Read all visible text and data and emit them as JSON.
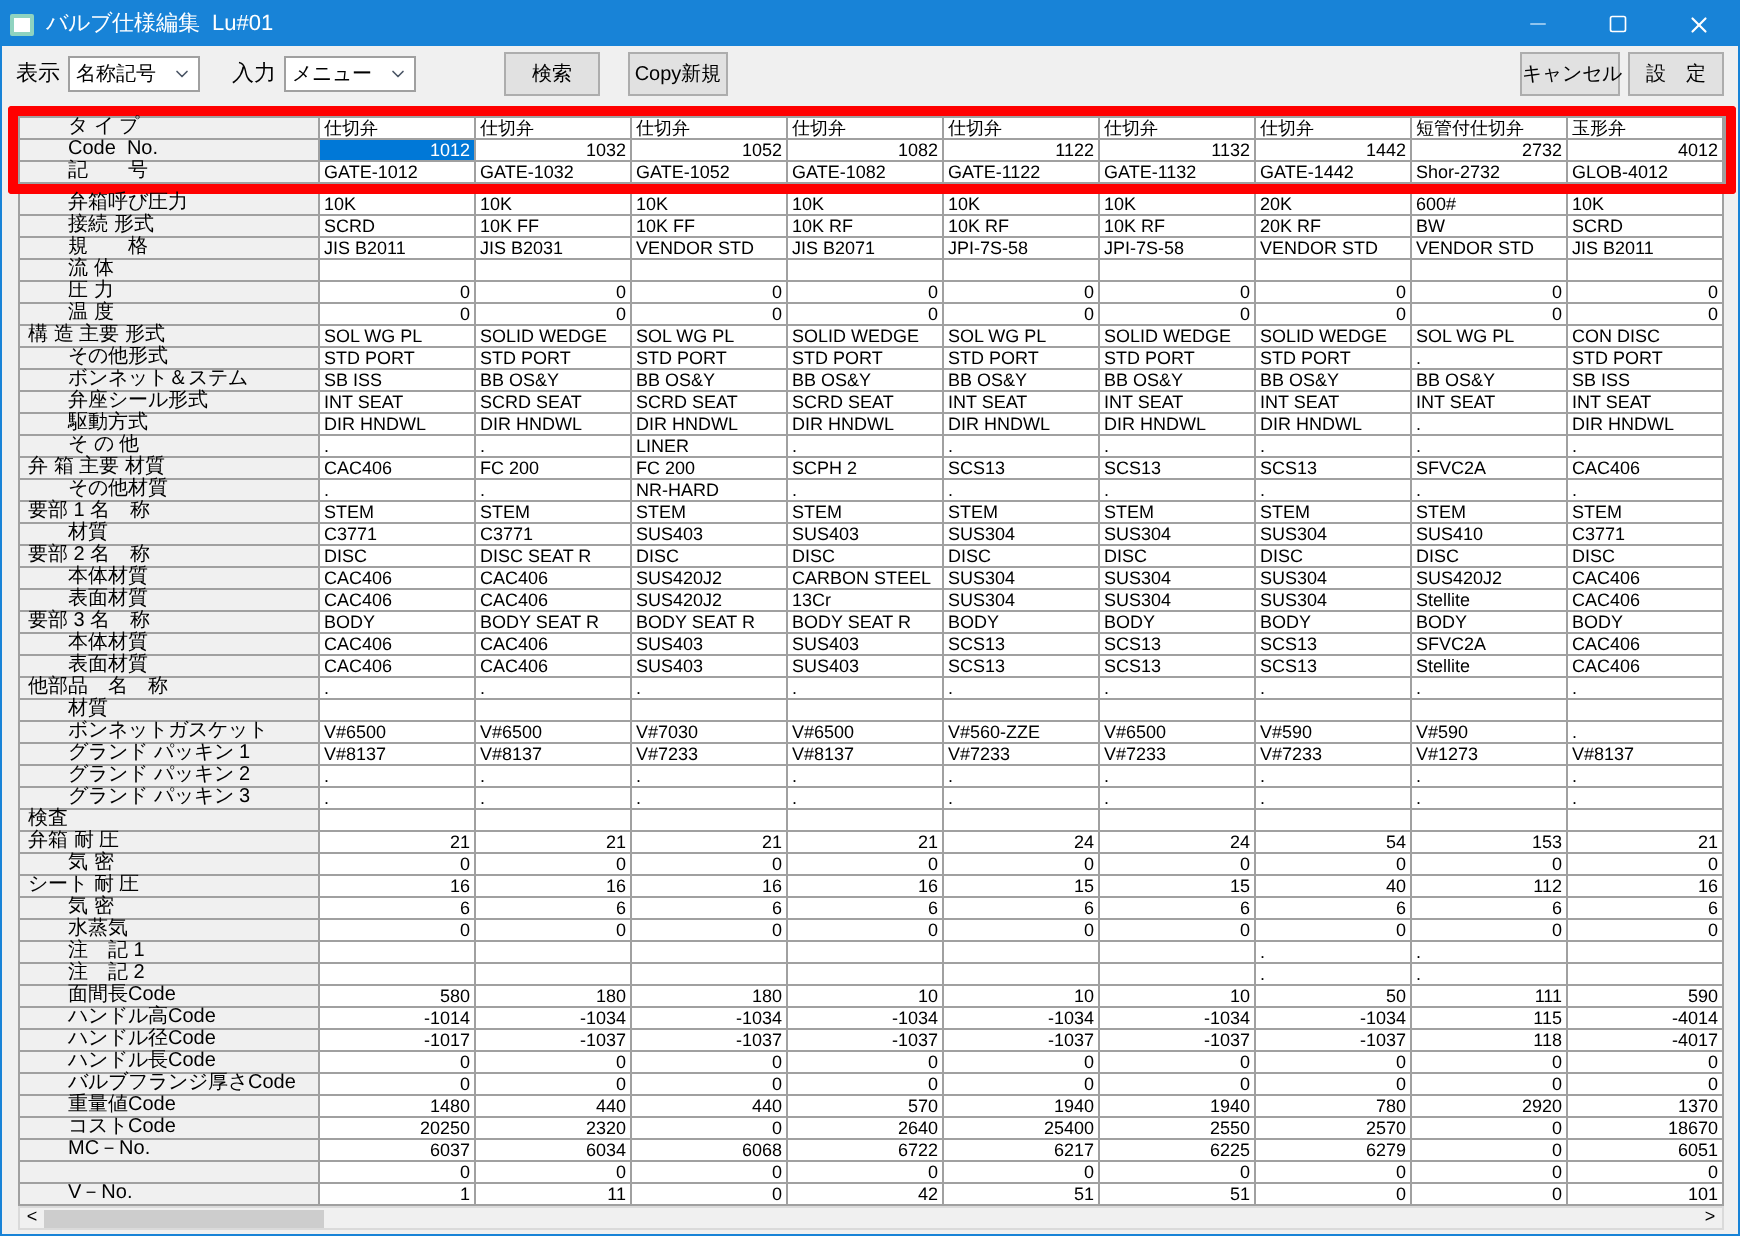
{
  "window": {
    "title": "バルブ仕様編集",
    "subtitle": "Lu#01"
  },
  "toolbar": {
    "display_label": "表示",
    "display_value": "名称記号",
    "input_label": "入力",
    "input_value": "メニュー",
    "search_button": "検索",
    "copy_button": "Copy新規",
    "cancel_button": "キャンセル",
    "ok_button": "設　定"
  },
  "rows": [
    {
      "label": "タ イ プ",
      "sub": true,
      "kind": "text",
      "highlighted": true,
      "values": [
        "仕切弁",
        "仕切弁",
        "仕切弁",
        "仕切弁",
        "仕切弁",
        "仕切弁",
        "仕切弁",
        "短管付仕切弁",
        "玉形弁"
      ]
    },
    {
      "label": "Code  No.",
      "sub": true,
      "kind": "number",
      "highlighted": true,
      "values": [
        {
          "text": "1012",
          "selected": true
        },
        {
          "text": "1032",
          "selected": false
        },
        {
          "text": "1052",
          "selected": false
        },
        {
          "text": "1082",
          "selected": false
        },
        {
          "text": "1122",
          "selected": false
        },
        {
          "text": "1132",
          "selected": false
        },
        {
          "text": "1442",
          "selected": false
        },
        {
          "text": "2732",
          "selected": false
        },
        {
          "text": "4012",
          "selected": false
        }
      ]
    },
    {
      "label": "記　　号",
      "sub": true,
      "kind": "text",
      "highlighted": true,
      "values": [
        "GATE-1012",
        "GATE-1032",
        "GATE-1052",
        "GATE-1082",
        "GATE-1122",
        "GATE-1132",
        "GATE-1442",
        "Shor-2732",
        "GLOB-4012"
      ]
    },
    {
      "label": "弁箱呼び圧力",
      "sub": true,
      "kind": "text",
      "highlighted": false,
      "values": [
        "10K",
        "10K",
        "10K",
        "10K",
        "10K",
        "10K",
        "20K",
        "600#",
        "10K"
      ]
    },
    {
      "label": "接続 形式",
      "sub": true,
      "kind": "text",
      "highlighted": false,
      "values": [
        "SCRD",
        "10K FF",
        "10K FF",
        "10K RF",
        "10K RF",
        "10K RF",
        "20K RF",
        "BW",
        "SCRD"
      ]
    },
    {
      "label": "規　　格",
      "sub": true,
      "kind": "text",
      "highlighted": false,
      "values": [
        "JIS B2011",
        "JIS B2031",
        "VENDOR STD",
        "JIS B2071",
        "JPI-7S-58",
        "JPI-7S-58",
        "VENDOR STD",
        "VENDOR STD",
        "JIS B2011"
      ]
    },
    {
      "label": "流 体",
      "sub": true,
      "kind": "text",
      "highlighted": false
    },
    {
      "label": "圧 力",
      "sub": true,
      "kind": "number",
      "highlighted": false,
      "values": [
        "0",
        "0",
        "0",
        "0",
        "0",
        "0",
        "0",
        "0",
        "0"
      ]
    },
    {
      "label": "温 度",
      "sub": true,
      "kind": "number",
      "highlighted": false,
      "values": [
        "0",
        "0",
        "0",
        "0",
        "0",
        "0",
        "0",
        "0",
        "0"
      ]
    },
    {
      "label": "構 造 主要 形式",
      "sub": false,
      "kind": "text",
      "highlighted": false,
      "values": [
        "SOL WG PL",
        "SOLID WEDGE",
        "SOL WG PL",
        "SOLID WEDGE",
        "SOL WG PL",
        "SOLID WEDGE",
        "SOLID WEDGE",
        "SOL WG PL",
        "CON DISC"
      ]
    },
    {
      "label": "その他形式",
      "sub": true,
      "kind": "text",
      "highlighted": false,
      "values": [
        "STD PORT",
        "STD PORT",
        "STD PORT",
        "STD PORT",
        "STD PORT",
        "STD PORT",
        "STD PORT",
        ".",
        "STD PORT"
      ]
    },
    {
      "label": "ボンネット＆ステム",
      "sub": true,
      "kind": "text",
      "highlighted": false,
      "values": [
        "SB ISS",
        "BB OS&Y",
        "BB OS&Y",
        "BB OS&Y",
        "BB OS&Y",
        "BB OS&Y",
        "BB OS&Y",
        "BB OS&Y",
        "SB ISS"
      ]
    },
    {
      "label": "弁座シール形式",
      "sub": true,
      "kind": "text",
      "highlighted": false,
      "values": [
        "INT SEAT",
        "SCRD SEAT",
        "SCRD SEAT",
        "SCRD SEAT",
        "INT SEAT",
        "INT SEAT",
        "INT SEAT",
        "INT SEAT",
        "INT SEAT"
      ]
    },
    {
      "label": "駆動方式",
      "sub": true,
      "kind": "text",
      "highlighted": false,
      "values": [
        "DIR HNDWL",
        "DIR HNDWL",
        "DIR HNDWL",
        "DIR HNDWL",
        "DIR HNDWL",
        "DIR HNDWL",
        "DIR HNDWL",
        ".",
        "DIR HNDWL"
      ]
    },
    {
      "label": "そ の 他",
      "sub": true,
      "kind": "text",
      "highlighted": false,
      "values": [
        ".",
        ".",
        "LINER",
        ".",
        ".",
        ".",
        ".",
        ".",
        "."
      ]
    },
    {
      "label": "弁 箱 主要 材質",
      "sub": false,
      "kind": "text",
      "highlighted": false,
      "values": [
        "CAC406",
        "FC 200",
        "FC 200",
        "SCPH 2",
        "SCS13",
        "SCS13",
        "SCS13",
        "SFVC2A",
        "CAC406"
      ]
    },
    {
      "label": "その他材質",
      "sub": true,
      "kind": "text",
      "highlighted": false,
      "values": [
        ".",
        ".",
        "NR-HARD",
        ".",
        ".",
        ".",
        ".",
        ".",
        "."
      ]
    },
    {
      "label": "要部 1 名　称",
      "sub": false,
      "kind": "text",
      "highlighted": false,
      "values": [
        "STEM",
        "STEM",
        "STEM",
        "STEM",
        "STEM",
        "STEM",
        "STEM",
        "STEM",
        "STEM"
      ]
    },
    {
      "label": "材質",
      "sub": true,
      "kind": "text",
      "highlighted": false,
      "values": [
        "C3771",
        "C3771",
        "SUS403",
        "SUS403",
        "SUS304",
        "SUS304",
        "SUS304",
        "SUS410",
        "C3771"
      ]
    },
    {
      "label": "要部 2 名　称",
      "sub": false,
      "kind": "text",
      "highlighted": false,
      "values": [
        "DISC",
        "DISC SEAT R",
        "DISC",
        "DISC",
        "DISC",
        "DISC",
        "DISC",
        "DISC",
        "DISC"
      ]
    },
    {
      "label": "本体材質",
      "sub": true,
      "kind": "text",
      "highlighted": false,
      "values": [
        "CAC406",
        "CAC406",
        "SUS420J2",
        "CARBON STEEL",
        "SUS304",
        "SUS304",
        "SUS304",
        "SUS420J2",
        "CAC406"
      ]
    },
    {
      "label": "表面材質",
      "sub": true,
      "kind": "text",
      "highlighted": false,
      "values": [
        "CAC406",
        "CAC406",
        "SUS420J2",
        "13Cr",
        "SUS304",
        "SUS304",
        "SUS304",
        "Stellite",
        "CAC406"
      ]
    },
    {
      "label": "要部 3 名　称",
      "sub": false,
      "kind": "text",
      "highlighted": false,
      "values": [
        "BODY",
        "BODY SEAT R",
        "BODY SEAT R",
        "BODY SEAT R",
        "BODY",
        "BODY",
        "BODY",
        "BODY",
        "BODY"
      ]
    },
    {
      "label": "本体材質",
      "sub": true,
      "kind": "text",
      "highlighted": false,
      "values": [
        "CAC406",
        "CAC406",
        "SUS403",
        "SUS403",
        "SCS13",
        "SCS13",
        "SCS13",
        "SFVC2A",
        "CAC406"
      ]
    },
    {
      "label": "表面材質",
      "sub": true,
      "kind": "text",
      "highlighted": false,
      "values": [
        "CAC406",
        "CAC406",
        "SUS403",
        "SUS403",
        "SCS13",
        "SCS13",
        "SCS13",
        "Stellite",
        "CAC406"
      ]
    },
    {
      "label": "他部品　名　称",
      "sub": false,
      "kind": "text",
      "highlighted": false,
      "values": [
        ".",
        ".",
        ".",
        ".",
        ".",
        ".",
        ".",
        ".",
        "."
      ]
    },
    {
      "label": "材質",
      "sub": true,
      "kind": "text",
      "highlighted": false
    },
    {
      "label": "ボンネットガスケット",
      "sub": true,
      "kind": "text",
      "highlighted": false,
      "values": [
        "V#6500",
        "V#6500",
        "V#7030",
        "V#6500",
        "V#560-ZZE",
        "V#6500",
        "V#590",
        "V#590",
        "."
      ]
    },
    {
      "label": "グランド パッキン 1",
      "sub": true,
      "kind": "text",
      "highlighted": false,
      "values": [
        "V#8137",
        "V#8137",
        "V#7233",
        "V#8137",
        "V#7233",
        "V#7233",
        "V#7233",
        "V#1273",
        "V#8137"
      ]
    },
    {
      "label": "グランド パッキン 2",
      "sub": true,
      "kind": "text",
      "highlighted": false,
      "values": [
        ".",
        ".",
        ".",
        ".",
        ".",
        ".",
        ".",
        ".",
        "."
      ]
    },
    {
      "label": "グランド パッキン 3",
      "sub": true,
      "kind": "text",
      "highlighted": false,
      "values": [
        ".",
        ".",
        ".",
        ".",
        ".",
        ".",
        ".",
        ".",
        "."
      ]
    },
    {
      "label": "検査",
      "sub": false,
      "kind": "text",
      "highlighted": false
    },
    {
      "label": "弁箱 耐 圧",
      "sub": false,
      "kind": "number",
      "highlighted": false,
      "values": [
        "21",
        "21",
        "21",
        "21",
        "24",
        "24",
        "54",
        "153",
        "21"
      ]
    },
    {
      "label": "気 密",
      "sub": true,
      "kind": "number",
      "highlighted": false,
      "values": [
        "0",
        "0",
        "0",
        "0",
        "0",
        "0",
        "0",
        "0",
        "0"
      ]
    },
    {
      "label": "シート 耐 圧",
      "sub": false,
      "kind": "number",
      "highlighted": false,
      "values": [
        "16",
        "16",
        "16",
        "16",
        "15",
        "15",
        "40",
        "112",
        "16"
      ]
    },
    {
      "label": "気 密",
      "sub": true,
      "kind": "number",
      "highlighted": false,
      "values": [
        "6",
        "6",
        "6",
        "6",
        "6",
        "6",
        "6",
        "6",
        "6"
      ]
    },
    {
      "label": "水蒸気",
      "sub": true,
      "kind": "number",
      "highlighted": false,
      "values": [
        "0",
        "0",
        "0",
        "0",
        "0",
        "0",
        "0",
        "0",
        "0"
      ]
    },
    {
      "label": "注　記 1",
      "sub": true,
      "kind": "text",
      "highlighted": false,
      "values": [
        {
          "kind": "blank"
        },
        {
          "kind": "blank"
        },
        {
          "kind": "blank"
        },
        {
          "kind": "blank"
        },
        {
          "kind": "blank"
        },
        {
          "kind": "blank"
        },
        {
          "kind": "text",
          "text": "."
        },
        {
          "kind": "text",
          "text": "."
        },
        {
          "kind": "blank"
        }
      ]
    },
    {
      "label": "注　記 2",
      "sub": true,
      "kind": "text",
      "highlighted": false,
      "values": [
        {
          "kind": "blank"
        },
        {
          "kind": "blank"
        },
        {
          "kind": "blank"
        },
        {
          "kind": "blank"
        },
        {
          "kind": "blank"
        },
        {
          "kind": "blank"
        },
        {
          "kind": "text",
          "text": "."
        },
        {
          "kind": "text",
          "text": "."
        },
        {
          "kind": "blank"
        }
      ]
    },
    {
      "label": "面間長Code",
      "sub": true,
      "kind": "number",
      "highlighted": false,
      "values": [
        "580",
        "180",
        "180",
        "10",
        "10",
        "10",
        "50",
        "111",
        "590"
      ]
    },
    {
      "label": "ハンドル高Code",
      "sub": true,
      "kind": "number",
      "highlighted": false,
      "values": [
        "-1014",
        "-1034",
        "-1034",
        "-1034",
        "-1034",
        "-1034",
        "-1034",
        "115",
        "-4014"
      ]
    },
    {
      "label": "ハンドル径Code",
      "sub": true,
      "kind": "number",
      "highlighted": false,
      "values": [
        "-1017",
        "-1037",
        "-1037",
        "-1037",
        "-1037",
        "-1037",
        "-1037",
        "118",
        "-4017"
      ]
    },
    {
      "label": "ハンドル長Code",
      "sub": true,
      "kind": "number",
      "highlighted": false,
      "values": [
        "0",
        "0",
        "0",
        "0",
        "0",
        "0",
        "0",
        "0",
        "0"
      ]
    },
    {
      "label": "バルブフランジ厚さCode",
      "sub": true,
      "kind": "number",
      "highlighted": false,
      "values": [
        "0",
        "0",
        "0",
        "0",
        "0",
        "0",
        "0",
        "0",
        "0"
      ]
    },
    {
      "label": "重量値Code",
      "sub": true,
      "kind": "number",
      "highlighted": false,
      "values": [
        "1480",
        "440",
        "440",
        "570",
        "1940",
        "1940",
        "780",
        "2920",
        "1370"
      ]
    },
    {
      "label": "コストCode",
      "sub": true,
      "kind": "number",
      "highlighted": false,
      "values": [
        "20250",
        "2320",
        "0",
        "2640",
        "25400",
        "2550",
        "2570",
        "0",
        "18670"
      ]
    },
    {
      "label": "MC－No.",
      "sub": true,
      "kind": "number",
      "highlighted": false,
      "values": [
        "6037",
        "6034",
        "6068",
        "6722",
        "6217",
        "6225",
        "6279",
        "0",
        "6051"
      ]
    },
    {
      "kind": "number",
      "highlighted": false,
      "values": [
        "0",
        "0",
        "0",
        "0",
        "0",
        "0",
        "0",
        "0",
        "0"
      ]
    },
    {
      "label": "V－No.",
      "sub": true,
      "kind": "number",
      "highlighted": false,
      "values": [
        "1",
        "11",
        "0",
        "42",
        "51",
        "51",
        "0",
        "0",
        "101"
      ]
    }
  ],
  "scrollbar": {
    "left_arrow": "<",
    "right_arrow": ">"
  }
}
